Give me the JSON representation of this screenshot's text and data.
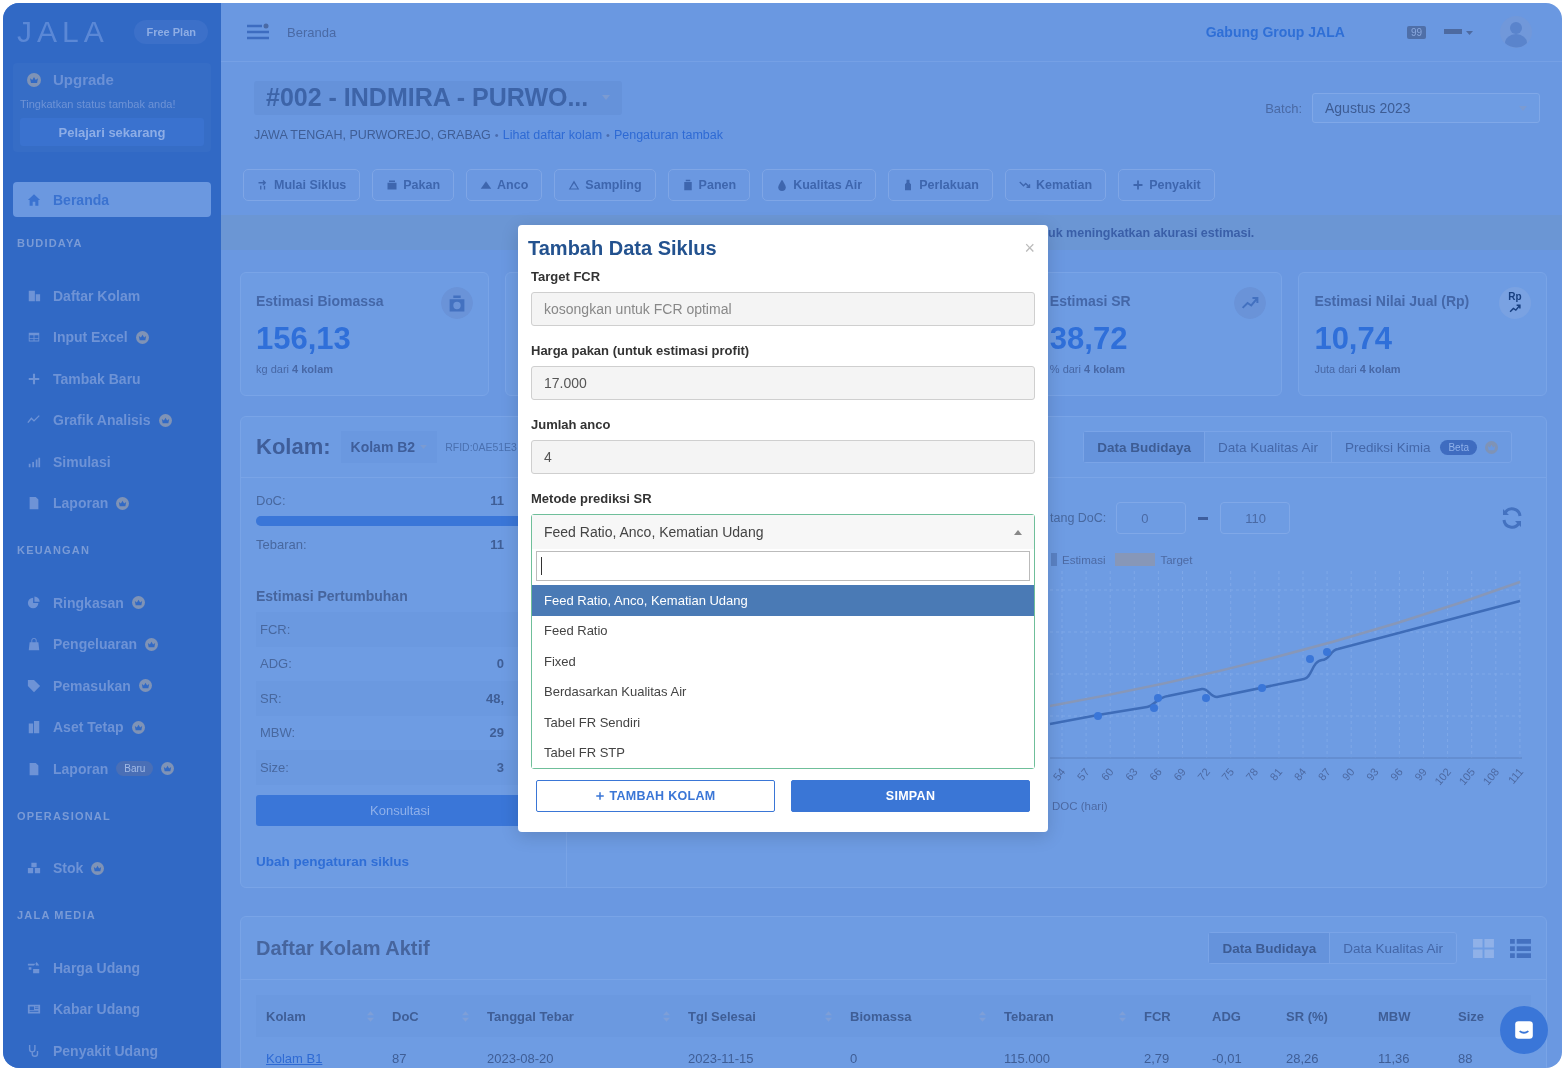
{
  "sidebar": {
    "logo": "JALA",
    "plan_badge": "Free Plan",
    "upgrade": {
      "title": "Upgrade",
      "text": "Tingkatkan status tambak anda!",
      "button": "Pelajari sekarang"
    },
    "home": {
      "label": "Beranda",
      "selected": true
    },
    "sections": [
      {
        "heading": "BUDIDAYA",
        "items": [
          {
            "label": "Daftar Kolam",
            "premium": false,
            "selected": false
          },
          {
            "label": "Input Excel",
            "premium": true,
            "selected": false
          },
          {
            "label": "Tambak Baru",
            "premium": false,
            "selected": false
          },
          {
            "label": "Grafik Analisis",
            "premium": true,
            "selected": false
          },
          {
            "label": "Simulasi",
            "premium": false,
            "selected": false
          },
          {
            "label": "Laporan",
            "premium": true,
            "selected": false
          }
        ]
      },
      {
        "heading": "KEUANGAN",
        "items": [
          {
            "label": "Ringkasan",
            "premium": true,
            "selected": false
          },
          {
            "label": "Pengeluaran",
            "premium": true,
            "selected": false
          },
          {
            "label": "Pemasukan",
            "premium": true,
            "selected": false
          },
          {
            "label": "Aset Tetap",
            "premium": true,
            "selected": false
          },
          {
            "label": "Laporan",
            "badge": "Baru",
            "premium": true,
            "selected": false
          }
        ]
      },
      {
        "heading": "OPERASIONAL",
        "items": [
          {
            "label": "Stok",
            "premium": true,
            "selected": false
          }
        ]
      },
      {
        "heading": "JALA MEDIA",
        "items": [
          {
            "label": "Harga Udang",
            "premium": false,
            "selected": false
          },
          {
            "label": "Kabar Udang",
            "premium": false,
            "selected": false
          },
          {
            "label": "Penyakit Udang",
            "premium": false,
            "selected": false
          }
        ]
      }
    ]
  },
  "header": {
    "breadcrumb": "Beranda",
    "group_link": "Gabung Group JALA",
    "notification_count": "99"
  },
  "farm": {
    "title": "#002 - INDMIRA - PURWO...",
    "location": "JAWA TENGAH, PURWOREJO, GRABAG",
    "separator": "•",
    "links": [
      "Lihat daftar kolam",
      "Pengaturan tambak"
    ],
    "batch_label": "Batch:",
    "batch_value": "Agustus 2023"
  },
  "actions": [
    "Mulai Siklus",
    "Pakan",
    "Anco",
    "Sampling",
    "Panen",
    "Kualitas Air",
    "Perlakuan",
    "Kematian",
    "Penyakit"
  ],
  "banner": "uk meningkatkan akurasi estimasi.",
  "stats": [
    {
      "kind": "stat",
      "title": "Estimasi Biomassa",
      "value": "156,13",
      "caption": "kg dari **4 kolam**"
    },
    {
      "kind": "covered"
    },
    {
      "kind": "stat",
      "title": "Estimasi SR",
      "value": "38,72",
      "caption": "% dari **4 kolam**"
    },
    {
      "kind": "stat",
      "title": "Estimasi Nilai Jual (Rp)",
      "value": "10,74",
      "caption": "Juta dari **4 kolam**",
      "icon_text": "Rp"
    }
  ],
  "pond": {
    "label": "Kolam:",
    "name": "Kolam B2",
    "rfid": "RFID:0AE51E3",
    "doc": {
      "label": "DoC:",
      "value": "11",
      "level": 1
    },
    "stocking": {
      "label": "Tebaran:",
      "value": "11"
    },
    "growth_heading": "Estimasi Pertumbuhan",
    "growth": [
      {
        "label": "FCR:"
      },
      {
        "label": "ADG:",
        "value": "0"
      },
      {
        "label": "SR:",
        "value": "48,"
      },
      {
        "label": "MBW:",
        "value": "29"
      },
      {
        "label": "Size:",
        "value": "3"
      }
    ],
    "button": "Konsultasi",
    "link": "Ubah pengaturan siklus"
  },
  "chart_panel": {
    "tabs": [
      {
        "label": "Data Budidaya",
        "selected": true
      },
      {
        "label": "Data Kualitas Air",
        "selected": false
      },
      {
        "label": "Prediksi Kimia",
        "badge": "Beta",
        "premium": true,
        "selected": false
      }
    ],
    "range": {
      "label": "tang DoC:",
      "from": "0",
      "to": "110"
    },
    "legend": [
      {
        "label": "Estimasi",
        "kind": "solid"
      },
      {
        "label": "Target",
        "kind": "dotted"
      }
    ],
    "x_ticks": [
      "54",
      "57",
      "60",
      "63",
      "66",
      "69",
      "72",
      "75",
      "78",
      "81",
      "84",
      "87",
      "90",
      "93",
      "96",
      "99",
      "102",
      "105",
      "108",
      "111"
    ],
    "xlabel": "DOC (hari)"
  },
  "pond_list": {
    "title": "Daftar Kolam Aktif",
    "tabs": [
      {
        "label": "Data Budidaya",
        "selected": true
      },
      {
        "label": "Data Kualitas Air",
        "selected": false
      }
    ],
    "view": [
      {
        "kind": "grid",
        "selected": false
      },
      {
        "kind": "list",
        "selected": true
      }
    ],
    "columns": [
      {
        "label": "Kolam",
        "sortable": true
      },
      {
        "label": "DoC",
        "sortable": true
      },
      {
        "label": "Tanggal Tebar",
        "sortable": true
      },
      {
        "label": "Tgl Selesai",
        "sortable": true
      },
      {
        "label": "Biomassa",
        "sortable": true
      },
      {
        "label": "Tebaran",
        "sortable": true
      },
      {
        "label": "FCR",
        "sortable": false
      },
      {
        "label": "ADG",
        "sortable": false
      },
      {
        "label": "SR (%)",
        "sortable": false
      },
      {
        "label": "MBW",
        "sortable": false
      },
      {
        "label": "Size",
        "sortable": false
      }
    ],
    "rows": [
      [
        "Kolam B1",
        "87",
        "2023-08-20",
        "2023-11-15",
        "0",
        "115.000",
        "2,79",
        "-0,01",
        "28,26",
        "11,36",
        "88"
      ]
    ]
  },
  "modal": {
    "title": "Tambah Data Siklus",
    "close": "×",
    "fields": [
      {
        "kind": "text",
        "label": "Target FCR",
        "placeholder": "kosongkan untuk FCR optimal"
      },
      {
        "kind": "text",
        "label": "Harga pakan (untuk estimasi profit)",
        "value": "17.000"
      },
      {
        "kind": "text",
        "label": "Jumlah anco",
        "value": "4"
      },
      {
        "kind": "select",
        "label": "Metode prediksi SR",
        "value": "Feed Ratio, Anco, Kematian Udang",
        "expanded": true,
        "options": [
          {
            "label": "Feed Ratio, Anco, Kematian Udang",
            "selected": true
          },
          {
            "label": "Feed Ratio",
            "selected": false
          },
          {
            "label": "Fixed",
            "selected": false
          },
          {
            "label": "Berdasarkan Kualitas Air",
            "selected": false
          },
          {
            "label": "Tabel FR Sendiri",
            "selected": false
          },
          {
            "label": "Tabel FR STP",
            "selected": false
          }
        ]
      }
    ],
    "buttons": [
      {
        "label": "TAMBAH KOLAM",
        "kind": "outline"
      },
      {
        "label": "SIMPAN",
        "kind": "primary"
      }
    ]
  }
}
